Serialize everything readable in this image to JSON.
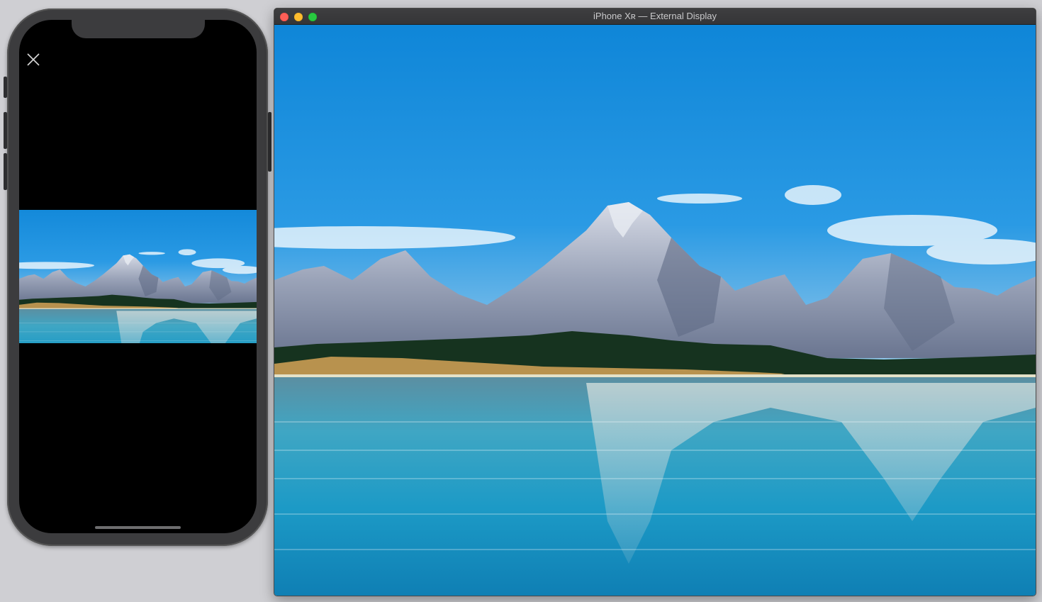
{
  "window": {
    "title": "iPhone Xʀ — External Display"
  },
  "phone": {
    "close_icon": "close-icon"
  },
  "colors": {
    "traffic_close": "#fe5f57",
    "traffic_minimize": "#febc2e",
    "traffic_zoom": "#28c840",
    "sky": "#1e8fe0",
    "lake": "#1a9cc4"
  }
}
